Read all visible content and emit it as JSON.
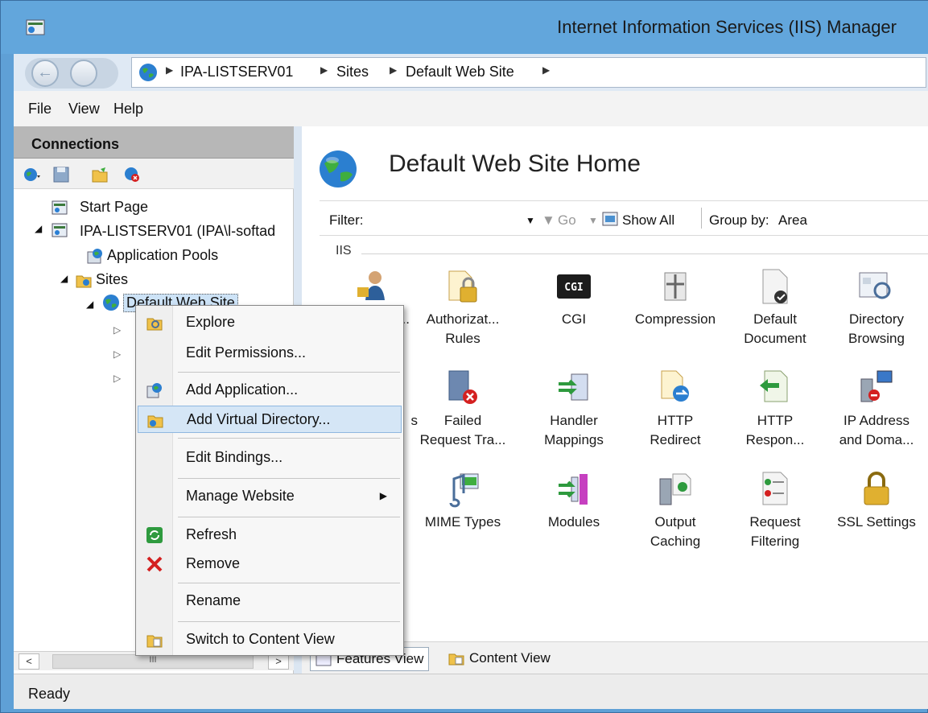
{
  "window": {
    "title": "Internet Information Services (IIS) Manager"
  },
  "breadcrumb": [
    "IPA-LISTSERV01",
    "Sites",
    "Default Web Site"
  ],
  "menubar": [
    "File",
    "View",
    "Help"
  ],
  "connections": {
    "title": "Connections",
    "tree": {
      "start_page": "Start Page",
      "server": "IPA-LISTSERV01 (IPA\\l-softad",
      "app_pools": "Application Pools",
      "sites": "Sites",
      "default_site": "Default Web Site"
    },
    "hscroll_thumb": "III"
  },
  "main": {
    "title": "Default Web Site Home",
    "filter_label": "Filter:",
    "go_label": "Go",
    "show_all_label": "Show All",
    "group_by_label": "Group by:",
    "group_by_value": "Area",
    "group_name": "IIS",
    "features": [
      {
        "label": "...",
        "icon": "auth-user-icon"
      },
      {
        "label": "Authorizat...\nRules",
        "icon": "lock-document-icon"
      },
      {
        "label": "CGI",
        "icon": "cgi-icon"
      },
      {
        "label": "Compression",
        "icon": "compression-icon"
      },
      {
        "label": "Default\nDocument",
        "icon": "default-document-icon"
      },
      {
        "label": "Directory\nBrowsing",
        "icon": "directory-browsing-icon"
      },
      {
        "label": "s",
        "icon": "error-pages-icon"
      },
      {
        "label": "Failed\nRequest Tra...",
        "icon": "failed-request-icon"
      },
      {
        "label": "Handler\nMappings",
        "icon": "handler-mappings-icon"
      },
      {
        "label": "HTTP\nRedirect",
        "icon": "http-redirect-icon"
      },
      {
        "label": "HTTP\nRespon...",
        "icon": "http-response-icon"
      },
      {
        "label": "IP Address\nand Doma...",
        "icon": "ip-address-icon"
      },
      {
        "label": "MIME Types",
        "icon": "mime-types-icon"
      },
      {
        "label": "Modules",
        "icon": "modules-icon"
      },
      {
        "label": "Output\nCaching",
        "icon": "output-caching-icon"
      },
      {
        "label": "Request\nFiltering",
        "icon": "request-filtering-icon"
      },
      {
        "label": "SSL Settings",
        "icon": "ssl-lock-icon"
      }
    ]
  },
  "viewtabs": {
    "features": "Features View",
    "content": "Content View"
  },
  "status": "Ready",
  "context_menu": {
    "explore": "Explore",
    "edit_permissions": "Edit Permissions...",
    "add_application": "Add Application...",
    "add_virtual_directory": "Add Virtual Directory...",
    "edit_bindings": "Edit Bindings...",
    "manage_website": "Manage Website",
    "refresh": "Refresh",
    "remove": "Remove",
    "rename": "Rename",
    "switch_content_view": "Switch to Content View"
  },
  "colors": {
    "title_bar": "#62a6dc",
    "highlight": "#d5e6f6",
    "remove_red": "#d42020"
  }
}
